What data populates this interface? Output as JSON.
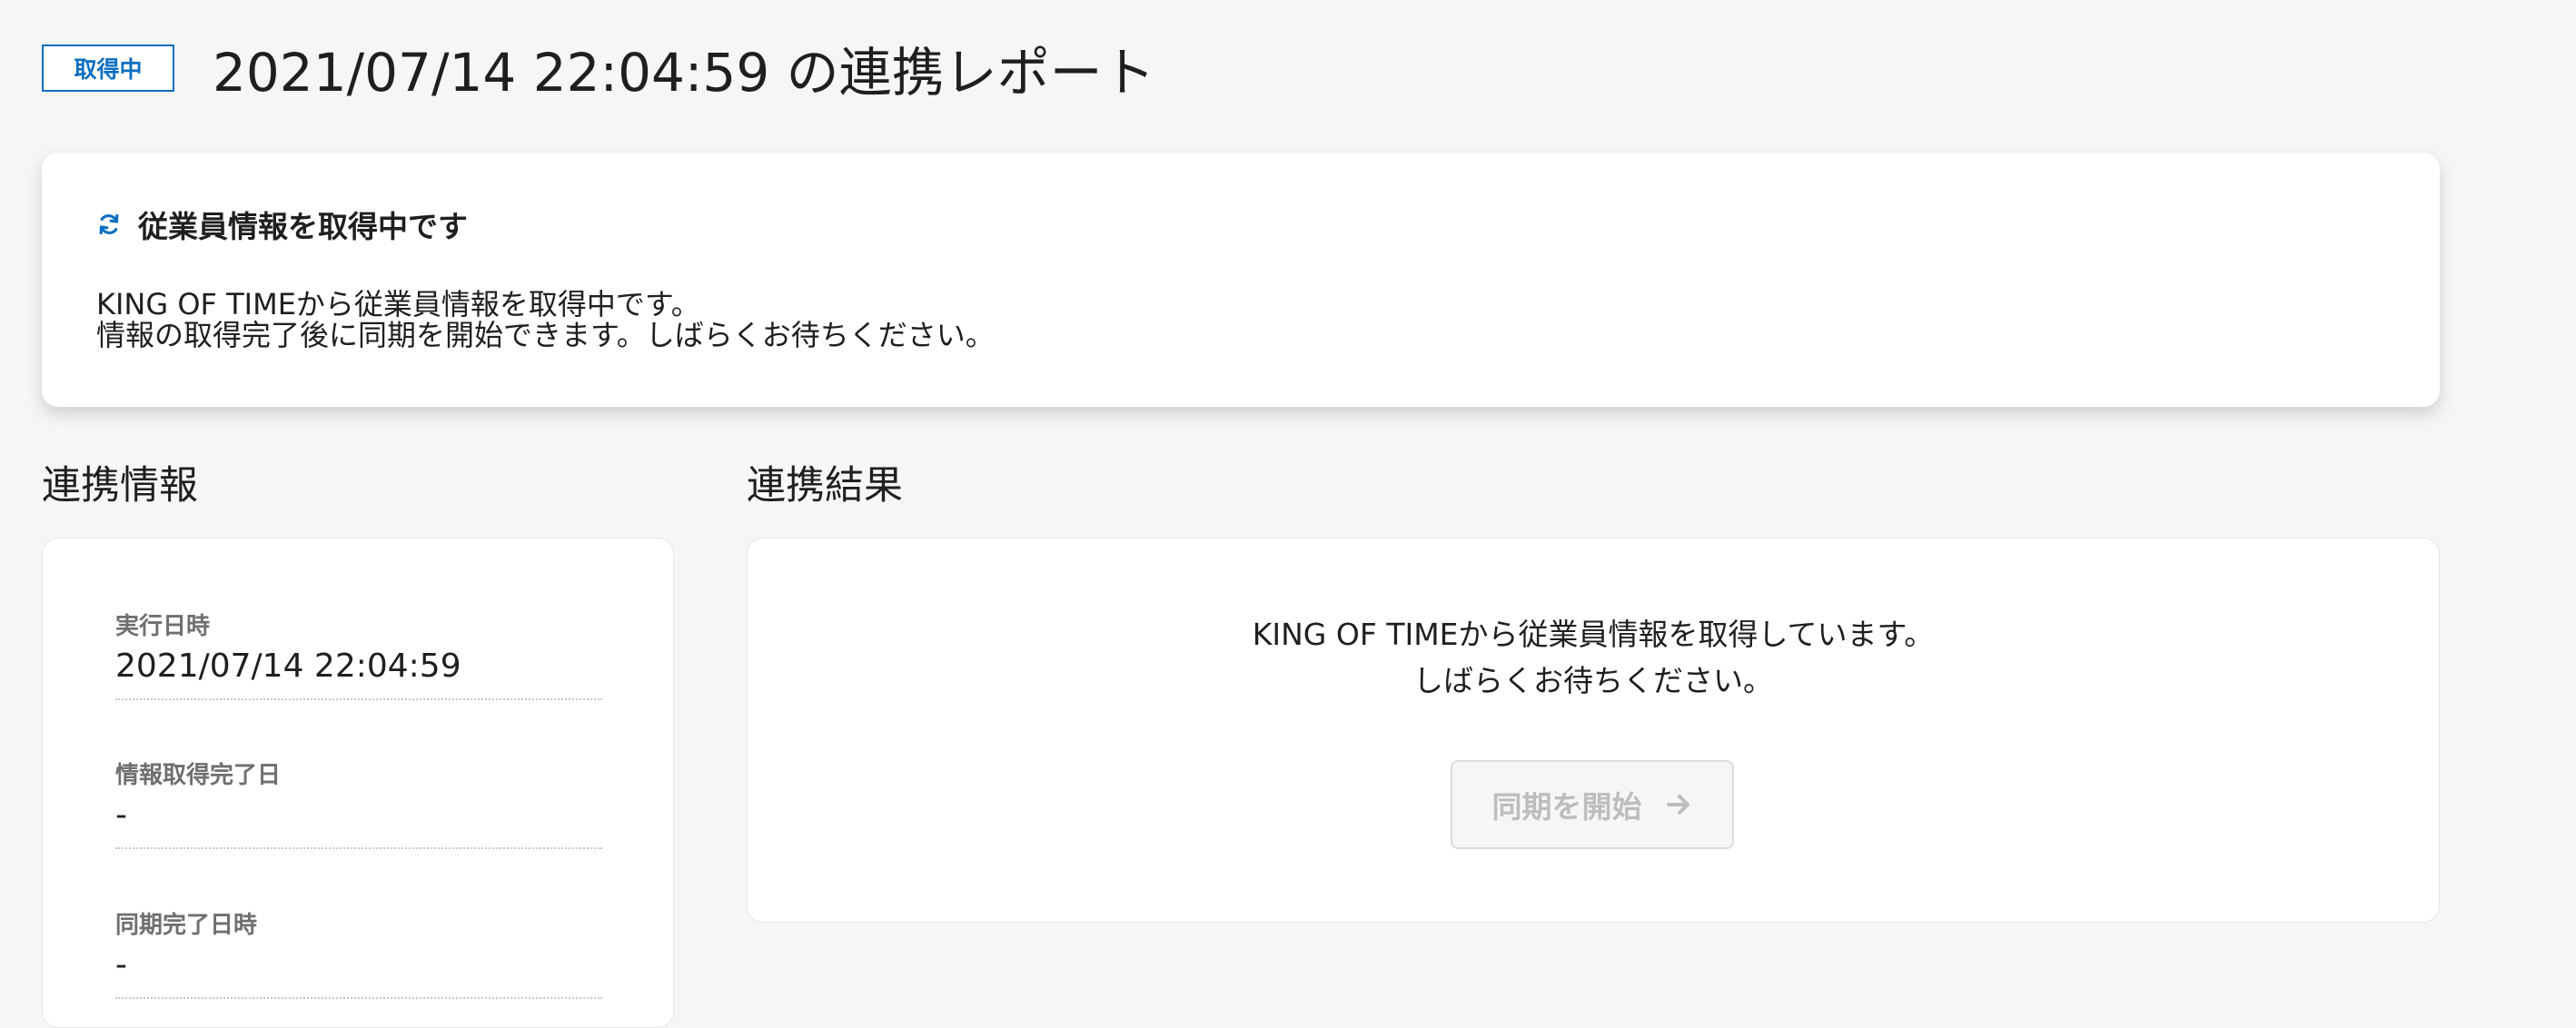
{
  "header": {
    "status_badge": "取得中",
    "title": "2021/07/14 22:04:59 の連携レポート"
  },
  "alert": {
    "title": "従業員情報を取得中です",
    "line1": "KING OF TIMEから従業員情報を取得中です。",
    "line2": "情報の取得完了後に同期を開始できます。しばらくお待ちください。",
    "icon": "refresh-icon"
  },
  "info": {
    "heading": "連携情報",
    "items": [
      {
        "label": "実行日時",
        "value": "2021/07/14 22:04:59"
      },
      {
        "label": "情報取得完了日",
        "value": "-"
      },
      {
        "label": "同期完了日時",
        "value": "-"
      }
    ]
  },
  "result": {
    "heading": "連携結果",
    "message_line1": "KING OF TIMEから従業員情報を取得しています。",
    "message_line2": "しばらくお待ちください。",
    "sync_button_label": "同期を開始",
    "sync_button_icon": "arrow-right-icon",
    "sync_button_disabled": true
  },
  "colors": {
    "accent": "#0a6fc2",
    "background": "#f7f6f5",
    "card": "#ffffff",
    "disabled_text": "#bdbdbd"
  }
}
